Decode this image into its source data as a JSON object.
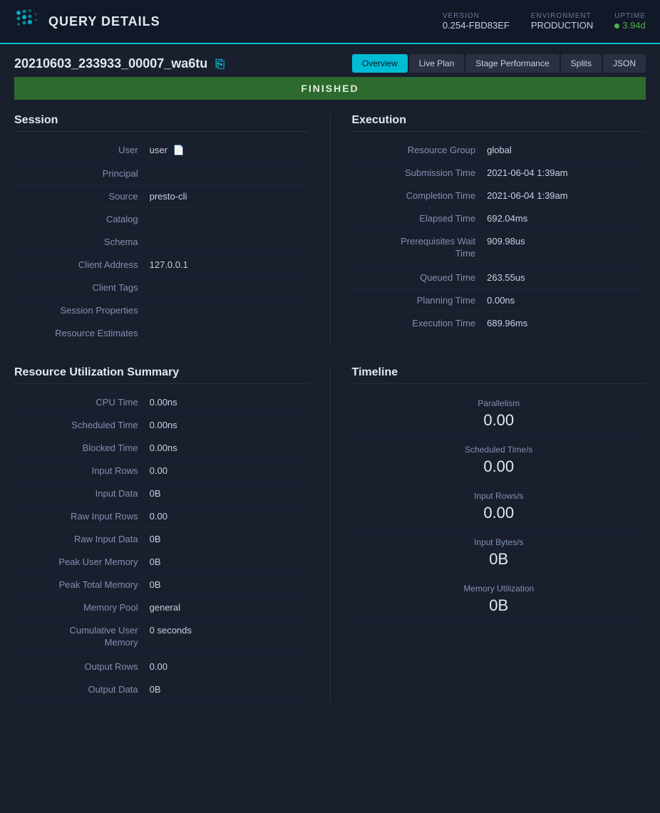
{
  "header": {
    "title": "QUERY DETAILS",
    "version_label": "VERSION",
    "version_value": "0.254-FBD83EF",
    "environment_label": "ENVIRONMENT",
    "environment_value": "PRODUCTION",
    "uptime_label": "UPTIME",
    "uptime_value": "3.94d"
  },
  "query": {
    "id": "20210603_233933_00007_wa6tu",
    "status": "FINISHED"
  },
  "tabs": {
    "overview": "Overview",
    "live_plan": "Live Plan",
    "stage_performance": "Stage Performance",
    "splits": "Splits",
    "json": "JSON"
  },
  "session": {
    "title": "Session",
    "user_label": "User",
    "user_value": "user",
    "principal_label": "Principal",
    "principal_value": "",
    "source_label": "Source",
    "source_value": "presto-cli",
    "catalog_label": "Catalog",
    "catalog_value": "",
    "schema_label": "Schema",
    "schema_value": "",
    "client_address_label": "Client Address",
    "client_address_value": "127.0.0.1",
    "client_tags_label": "Client Tags",
    "client_tags_value": "",
    "session_properties_label": "Session Properties",
    "session_properties_value": "",
    "resource_estimates_label": "Resource Estimates",
    "resource_estimates_value": ""
  },
  "execution": {
    "title": "Execution",
    "resource_group_label": "Resource Group",
    "resource_group_value": "global",
    "submission_time_label": "Submission Time",
    "submission_time_value": "2021-06-04 1:39am",
    "completion_time_label": "Completion Time",
    "completion_time_value": "2021-06-04 1:39am",
    "elapsed_time_label": "Elapsed Time",
    "elapsed_time_value": "692.04ms",
    "prereq_wait_label": "Prerequisites Wait Time",
    "prereq_wait_value": "909.98us",
    "queued_time_label": "Queued Time",
    "queued_time_value": "263.55us",
    "planning_time_label": "Planning Time",
    "planning_time_value": "0.00ns",
    "execution_time_label": "Execution Time",
    "execution_time_value": "689.96ms"
  },
  "resource_utilization": {
    "title": "Resource Utilization Summary",
    "cpu_time_label": "CPU Time",
    "cpu_time_value": "0.00ns",
    "scheduled_time_label": "Scheduled Time",
    "scheduled_time_value": "0.00ns",
    "blocked_time_label": "Blocked Time",
    "blocked_time_value": "0.00ns",
    "input_rows_label": "Input Rows",
    "input_rows_value": "0.00",
    "input_data_label": "Input Data",
    "input_data_value": "0B",
    "raw_input_rows_label": "Raw Input Rows",
    "raw_input_rows_value": "0.00",
    "raw_input_data_label": "Raw Input Data",
    "raw_input_data_value": "0B",
    "peak_user_memory_label": "Peak User Memory",
    "peak_user_memory_value": "0B",
    "peak_total_memory_label": "Peak Total Memory",
    "peak_total_memory_value": "0B",
    "memory_pool_label": "Memory Pool",
    "memory_pool_value": "general",
    "cumulative_user_memory_label": "Cumulative User Memory",
    "cumulative_user_memory_value": "0 seconds",
    "output_rows_label": "Output Rows",
    "output_rows_value": "0.00",
    "output_data_label": "Output Data",
    "output_data_value": "0B"
  },
  "timeline": {
    "title": "Timeline",
    "parallelism_label": "Parallelism",
    "parallelism_value": "0.00",
    "scheduled_time_s_label": "Scheduled Time/s",
    "scheduled_time_s_value": "0.00",
    "input_rows_s_label": "Input Rows/s",
    "input_rows_s_value": "0.00",
    "input_bytes_s_label": "Input Bytes/s",
    "input_bytes_s_value": "0B",
    "memory_utilization_label": "Memory Utilization",
    "memory_utilization_value": "0B"
  }
}
